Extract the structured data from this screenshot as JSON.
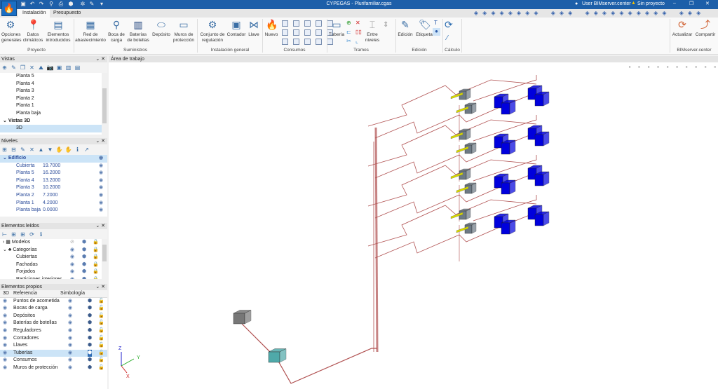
{
  "window": {
    "title": "CYPEGAS - Plurifamiliar.cgas",
    "user": "User BIMserver.center",
    "project": "Sin proyecto"
  },
  "tabs": [
    "Instalación",
    "Presupuesto"
  ],
  "ribbon": {
    "groups": [
      {
        "label": "Proyecto",
        "buttons": [
          "Opciones\ngenerales",
          "Datos\nclimáticos",
          "Elementos\nintroducidos"
        ]
      },
      {
        "label": "Suministros",
        "buttons": [
          "Red de\nabastecimiento",
          "Boca de\ncarga",
          "Baterías\nde botellas",
          "Depósito",
          "Muros de\nprotección"
        ]
      },
      {
        "label": "Instalación general",
        "buttons": [
          "Conjunto de\nregulación",
          "Contador",
          "Llave"
        ]
      },
      {
        "label": "Consumos",
        "buttons": [
          "Nuevo"
        ]
      },
      {
        "label": "Tramos",
        "buttons": [
          "Tubería",
          "Entre\nniveles"
        ]
      },
      {
        "label": "Edición",
        "buttons": [
          "Edición",
          "Etiqueta"
        ]
      },
      {
        "label": "Cálculo",
        "buttons": []
      },
      {
        "label": "BIMserver.center",
        "buttons": [
          "Actualizar",
          "Compartir"
        ]
      }
    ]
  },
  "vistas": {
    "title": "Vistas",
    "items": [
      "Planta 5",
      "Planta 4",
      "Planta 3",
      "Planta 2",
      "Planta 1",
      "Planta baja"
    ],
    "group3d": "Vistas 3D",
    "item3d": "3D"
  },
  "niveles": {
    "title": "Niveles",
    "root": "Edificio",
    "levels": [
      {
        "name": "Cubierta",
        "z": "19.7000"
      },
      {
        "name": "Planta 5",
        "z": "16.2000"
      },
      {
        "name": "Planta 4",
        "z": "13.2000"
      },
      {
        "name": "Planta 3",
        "z": "10.2000"
      },
      {
        "name": "Planta 2",
        "z": "7.2000"
      },
      {
        "name": "Planta 1",
        "z": "4.2000"
      },
      {
        "name": "Planta baja",
        "z": "0.0000"
      }
    ]
  },
  "leidos": {
    "title": "Elementos leídos",
    "modelos": "Modelos",
    "categorias": "Categorías",
    "items": [
      "Cubiertas",
      "Fachadas",
      "Forjados",
      "Particiones interiores"
    ]
  },
  "propios": {
    "title": "Elementos propios",
    "cols": [
      "3D",
      "Referencia",
      "Simbología"
    ],
    "items": [
      "Puntos de acometida",
      "Bocas de carga",
      "Depósitos",
      "Baterías de botellas",
      "Reguladores",
      "Contadores",
      "Llaves",
      "Tuberías",
      "Consumos",
      "Muros de protección"
    ],
    "selected": "Tuberías"
  },
  "workspace": {
    "title": "Área de trabajo",
    "axes": {
      "x": "X",
      "y": "Y",
      "z": "Z"
    }
  },
  "colors": {
    "titlebar": "#1d5fa9",
    "selection": "#cce4f7",
    "pipe": "#b05050",
    "consumer": "#0000dd",
    "meter": "#6d7a85",
    "valve": "#d8d800",
    "tank": "#4fa9a9"
  }
}
